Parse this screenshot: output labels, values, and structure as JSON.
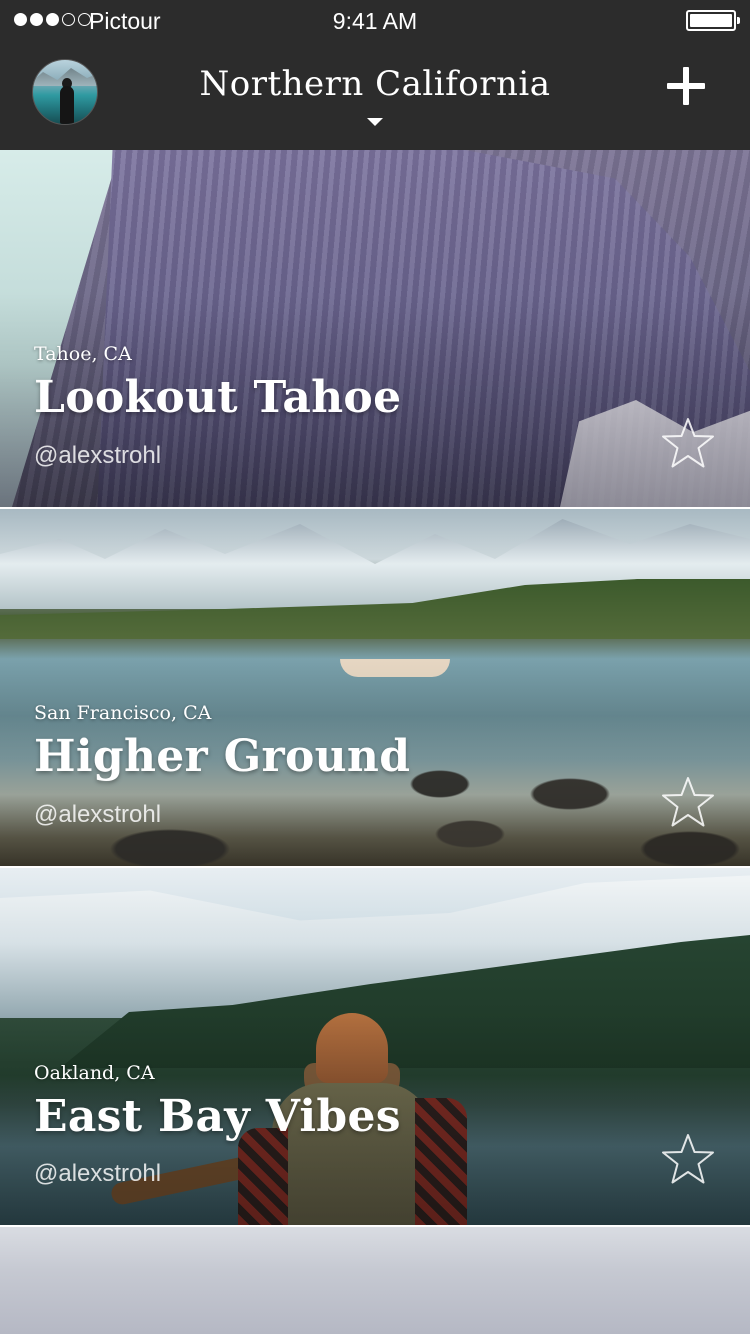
{
  "status_bar": {
    "carrier": "Pictour",
    "time": "9:41 AM",
    "signal_bars_filled": 3,
    "signal_bars_total": 5,
    "battery_level": 1.0
  },
  "nav": {
    "title": "Northern California",
    "avatar_icon": "user-avatar",
    "add_icon": "plus-icon",
    "dropdown_icon": "caret-down-icon"
  },
  "cards": [
    {
      "location": "Tahoe, CA",
      "title": "Lookout Tahoe",
      "author": "@alexstrohl",
      "favorite_icon": "star-outline-icon",
      "favorited": false
    },
    {
      "location": "San Francisco, CA",
      "title": "Higher Ground",
      "author": "@alexstrohl",
      "favorite_icon": "star-outline-icon",
      "favorited": false
    },
    {
      "location": "Oakland, CA",
      "title": "East Bay Vibes",
      "author": "@alexstrohl",
      "favorite_icon": "star-outline-icon",
      "favorited": false
    }
  ],
  "colors": {
    "bar_background": "#2c2c2c",
    "text_light": "#ffffff"
  }
}
